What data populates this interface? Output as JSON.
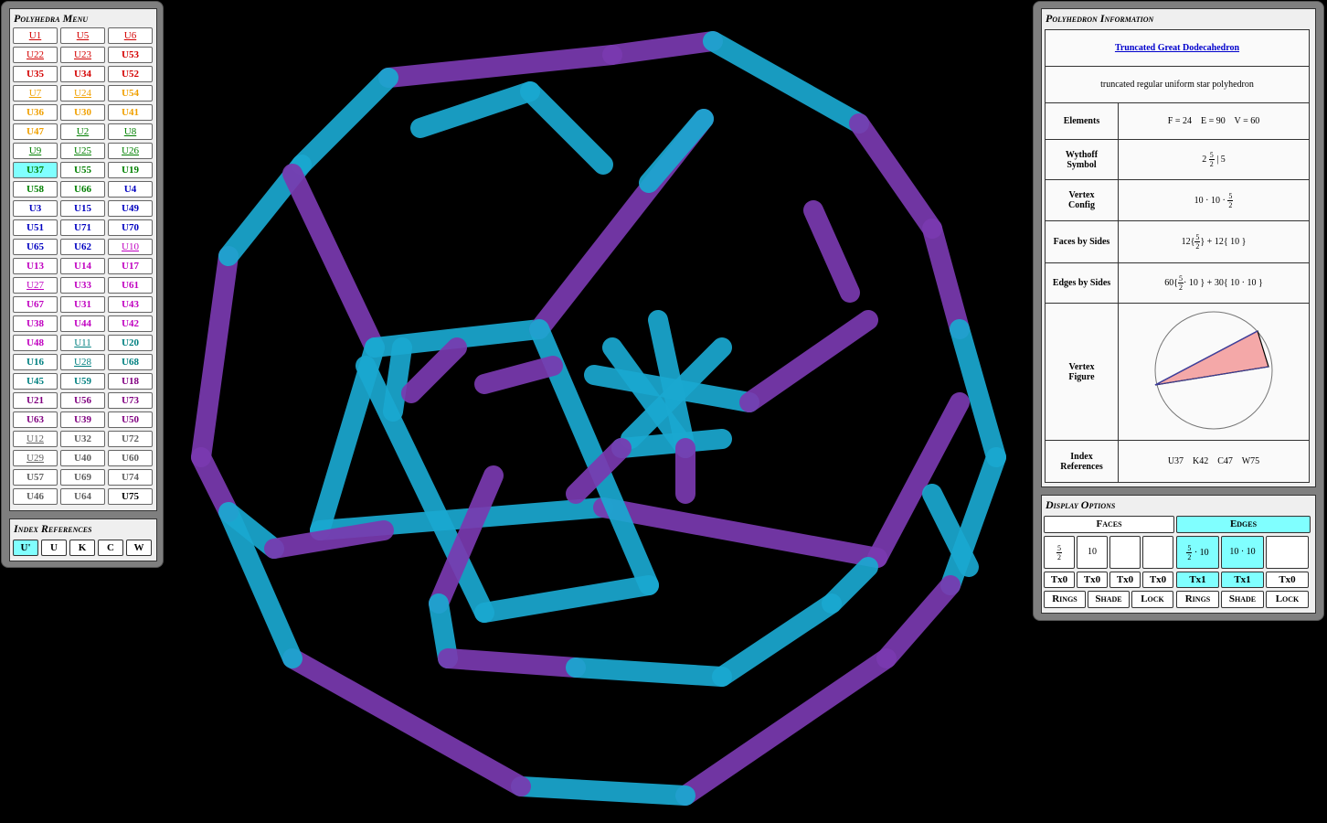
{
  "menu": {
    "title": "Polyhedra Menu",
    "items": [
      {
        "label": "U1",
        "color": "#d40000",
        "u": true
      },
      {
        "label": "U5",
        "color": "#d40000",
        "u": true
      },
      {
        "label": "U6",
        "color": "#d40000",
        "u": true
      },
      {
        "label": "U22",
        "color": "#d40000",
        "u": true
      },
      {
        "label": "U23",
        "color": "#d40000",
        "u": true
      },
      {
        "label": "U53",
        "color": "#d40000",
        "u": false
      },
      {
        "label": "U35",
        "color": "#d40000",
        "u": false
      },
      {
        "label": "U34",
        "color": "#d40000",
        "u": false
      },
      {
        "label": "U52",
        "color": "#d40000",
        "u": false
      },
      {
        "label": "U7",
        "color": "#f0a000",
        "u": true
      },
      {
        "label": "U24",
        "color": "#f0a000",
        "u": true
      },
      {
        "label": "U54",
        "color": "#f0a000",
        "u": false
      },
      {
        "label": "U36",
        "color": "#f0a000",
        "u": false
      },
      {
        "label": "U30",
        "color": "#f0a000",
        "u": false
      },
      {
        "label": "U41",
        "color": "#f0a000",
        "u": false
      },
      {
        "label": "U47",
        "color": "#f0a000",
        "u": false
      },
      {
        "label": "U2",
        "color": "#008000",
        "u": true
      },
      {
        "label": "U8",
        "color": "#008000",
        "u": true
      },
      {
        "label": "U9",
        "color": "#008000",
        "u": true
      },
      {
        "label": "U25",
        "color": "#008000",
        "u": true
      },
      {
        "label": "U26",
        "color": "#008000",
        "u": true
      },
      {
        "label": "U37",
        "color": "#008000",
        "u": false,
        "sel": true
      },
      {
        "label": "U55",
        "color": "#008000",
        "u": false
      },
      {
        "label": "U19",
        "color": "#008000",
        "u": false
      },
      {
        "label": "U58",
        "color": "#008000",
        "u": false
      },
      {
        "label": "U66",
        "color": "#008000",
        "u": false
      },
      {
        "label": "U4",
        "color": "#0000c0",
        "u": false
      },
      {
        "label": "U3",
        "color": "#0000c0",
        "u": false
      },
      {
        "label": "U15",
        "color": "#0000c0",
        "u": false
      },
      {
        "label": "U49",
        "color": "#0000c0",
        "u": false
      },
      {
        "label": "U51",
        "color": "#0000c0",
        "u": false
      },
      {
        "label": "U71",
        "color": "#0000c0",
        "u": false
      },
      {
        "label": "U70",
        "color": "#0000c0",
        "u": false
      },
      {
        "label": "U65",
        "color": "#0000c0",
        "u": false
      },
      {
        "label": "U62",
        "color": "#0000c0",
        "u": false
      },
      {
        "label": "U10",
        "color": "#c000c0",
        "u": true
      },
      {
        "label": "U13",
        "color": "#c000c0",
        "u": false
      },
      {
        "label": "U14",
        "color": "#c000c0",
        "u": false
      },
      {
        "label": "U17",
        "color": "#c000c0",
        "u": false
      },
      {
        "label": "U27",
        "color": "#c000c0",
        "u": true
      },
      {
        "label": "U33",
        "color": "#c000c0",
        "u": false
      },
      {
        "label": "U61",
        "color": "#c000c0",
        "u": false
      },
      {
        "label": "U67",
        "color": "#c000c0",
        "u": false
      },
      {
        "label": "U31",
        "color": "#c000c0",
        "u": false
      },
      {
        "label": "U43",
        "color": "#c000c0",
        "u": false
      },
      {
        "label": "U38",
        "color": "#c000c0",
        "u": false
      },
      {
        "label": "U44",
        "color": "#c000c0",
        "u": false
      },
      {
        "label": "U42",
        "color": "#c000c0",
        "u": false
      },
      {
        "label": "U48",
        "color": "#c000c0",
        "u": false
      },
      {
        "label": "U11",
        "color": "#008080",
        "u": true
      },
      {
        "label": "U20",
        "color": "#008080",
        "u": false
      },
      {
        "label": "U16",
        "color": "#008080",
        "u": false
      },
      {
        "label": "U28",
        "color": "#008080",
        "u": true
      },
      {
        "label": "U68",
        "color": "#008080",
        "u": false
      },
      {
        "label": "U45",
        "color": "#008080",
        "u": false
      },
      {
        "label": "U59",
        "color": "#008080",
        "u": false
      },
      {
        "label": "U18",
        "color": "#800080",
        "u": false
      },
      {
        "label": "U21",
        "color": "#800080",
        "u": false
      },
      {
        "label": "U56",
        "color": "#800080",
        "u": false
      },
      {
        "label": "U73",
        "color": "#800080",
        "u": false
      },
      {
        "label": "U63",
        "color": "#800080",
        "u": false
      },
      {
        "label": "U39",
        "color": "#800080",
        "u": false
      },
      {
        "label": "U50",
        "color": "#800080",
        "u": false
      },
      {
        "label": "U12",
        "color": "#606060",
        "u": true
      },
      {
        "label": "U32",
        "color": "#606060",
        "u": false
      },
      {
        "label": "U72",
        "color": "#606060",
        "u": false
      },
      {
        "label": "U29",
        "color": "#606060",
        "u": true
      },
      {
        "label": "U40",
        "color": "#606060",
        "u": false
      },
      {
        "label": "U60",
        "color": "#606060",
        "u": false
      },
      {
        "label": "U57",
        "color": "#606060",
        "u": false
      },
      {
        "label": "U69",
        "color": "#606060",
        "u": false
      },
      {
        "label": "U74",
        "color": "#606060",
        "u": false
      },
      {
        "label": "U46",
        "color": "#606060",
        "u": false
      },
      {
        "label": "U64",
        "color": "#606060",
        "u": false
      },
      {
        "label": "U75",
        "color": "#000000",
        "u": false
      }
    ]
  },
  "index_refs": {
    "title": "Index References",
    "buttons": [
      {
        "label": "U'",
        "sel": true
      },
      {
        "label": "U"
      },
      {
        "label": "K"
      },
      {
        "label": "C"
      },
      {
        "label": "W"
      }
    ]
  },
  "info": {
    "title": "Polyhedron Information",
    "name": "Truncated Great Dodecahedron",
    "description": "truncated regular uniform star polyhedron",
    "elements_label": "Elements",
    "elements_value": "F = 24    E = 90    V = 60",
    "wythoff_label_1": "Wythoff",
    "wythoff_label_2": "Symbol",
    "wythoff_pre": "2",
    "wythoff_num": "5",
    "wythoff_den": "2",
    "wythoff_post": "| 5",
    "vertex_config_label_1": "Vertex",
    "vertex_config_label_2": "Config",
    "vertex_config_pre": "10 · 10 ·",
    "vertex_config_num": "5",
    "vertex_config_den": "2",
    "faces_label": "Faces by Sides",
    "faces_pre": "12{",
    "faces_num": "5",
    "faces_den": "2",
    "faces_post": "} + 12{ 10 }",
    "edges_label": "Edges by Sides",
    "edges_pre": "60{",
    "edges_num": "5",
    "edges_den": "2",
    "edges_post": "· 10 } + 30{ 10 · 10 }",
    "vfig_label_1": "Vertex",
    "vfig_label_2": "Figure",
    "index_label_1": "Index",
    "index_label_2": "References",
    "index_value": "U37    K42    C47    W75"
  },
  "display": {
    "title": "Display Options",
    "faces_header": "Faces",
    "edges_header": "Edges",
    "face_cells": [
      {
        "num": "5",
        "den": "2"
      },
      {
        "text": "10"
      },
      {
        "text": ""
      },
      {
        "text": ""
      }
    ],
    "edge_cells": [
      {
        "num": "5",
        "den": "2",
        "post": "· 10",
        "sel": true
      },
      {
        "text": "10 · 10",
        "sel": true
      },
      {
        "text": ""
      }
    ],
    "face_tx": [
      "Tx0",
      "Tx0",
      "Tx0",
      "Tx0"
    ],
    "edge_tx": [
      {
        "label": "Tx1",
        "sel": true
      },
      {
        "label": "Tx1",
        "sel": true
      },
      {
        "label": "Tx0"
      }
    ],
    "face_opts": [
      "Rings",
      "Shade",
      "Lock"
    ],
    "edge_opts": [
      "Rings",
      "Shade",
      "Lock"
    ]
  },
  "colors": {
    "purple_edge": "#7a3ab0",
    "cyan_edge": "#1aa8d0",
    "selected": "#80ffff"
  }
}
